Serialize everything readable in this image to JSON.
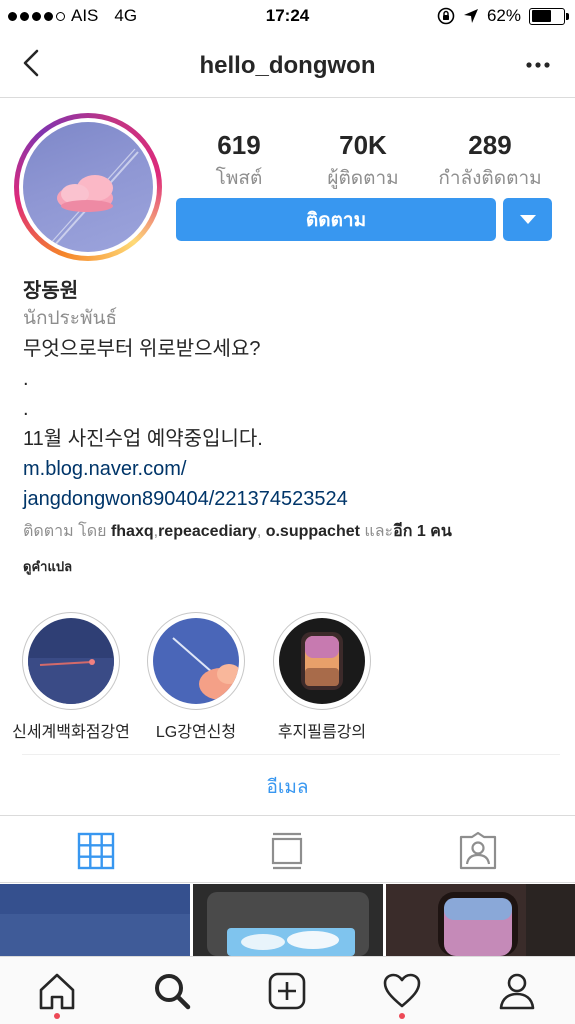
{
  "status_bar": {
    "carrier": "AIS",
    "network": "4G",
    "time": "17:24",
    "battery": "62%",
    "battery_level": 0.62,
    "signal_bars_filled": 4,
    "signal_bars_total": 5
  },
  "header": {
    "username": "hello_dongwon",
    "back_icon": "chevron-left-icon",
    "more_icon": "ellipsis-icon"
  },
  "profile": {
    "stats": [
      {
        "value": "619",
        "label": "โพสต์"
      },
      {
        "value": "70K",
        "label": "ผู้ติดตาม"
      },
      {
        "value": "289",
        "label": "กำลังติดตาม"
      }
    ],
    "follow_button": "ติดตาม",
    "name": "장동원",
    "category": "นักประพันธ์",
    "bio_lines": [
      "무엇으로부터 위로받으세요?",
      ".",
      ".",
      "11월 사진수업 예약중입니다."
    ],
    "link_lines": [
      "m.blog.naver.com/",
      "jangdongwon890404/221374523524"
    ],
    "followed_by": {
      "prefix": "ติดตาม โดย ",
      "user1": "fhaxq",
      "sep1": ",",
      "user2": "repeacediary",
      "sep2": ", ",
      "user3": "o.suppachet",
      "and": " และ",
      "more": "อีก 1 คน"
    },
    "translate": "ดูคำแปล"
  },
  "highlights": [
    {
      "label": "신세계백화점강연"
    },
    {
      "label": "LG강연신청"
    },
    {
      "label": "후지필름강의"
    }
  ],
  "contact": {
    "email": "อีเมล"
  },
  "tabs": [
    "grid-icon",
    "feed-icon",
    "tagged-icon"
  ],
  "bottom_nav": [
    "home-icon",
    "search-icon",
    "new-post-icon",
    "activity-icon",
    "profile-icon"
  ],
  "colors": {
    "accent": "#3897f0",
    "link": "#003569",
    "muted": "#8e8e8e",
    "notification": "#ed4956"
  }
}
